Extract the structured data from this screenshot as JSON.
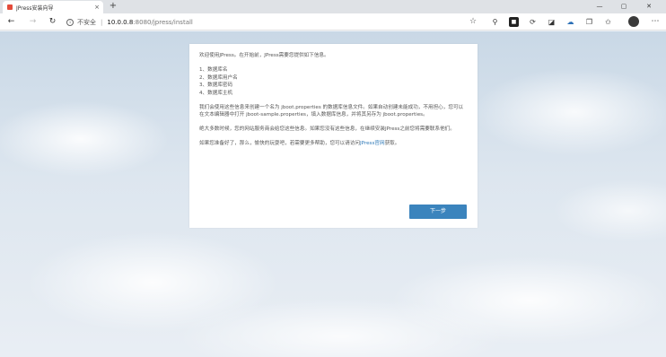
{
  "browser": {
    "tab_title": "JPress安装向导",
    "tab_close": "×",
    "new_tab": "+",
    "win_min": "—",
    "win_max": "▢",
    "win_close": "✕",
    "back": "←",
    "forward": "→",
    "reload": "↻",
    "security_label": "不安全",
    "separator": "|",
    "url_host": "10.0.0.8",
    "url_rest": ":8080/jpress/install",
    "star": "☆",
    "menu": "⋯"
  },
  "install": {
    "intro": "欢迎使用JPress。在开始前，JPress需要您提供如下信息。",
    "items": [
      "1、数据库名",
      "2、数据库用户名",
      "3、数据库密码",
      "4、数据库主机"
    ],
    "para1": "我们会使用这些信息来创建一个名为 jboot.properties 的数据库信息文件。如果自动创建未能成功，不用担心，您可以在文本编辑器中打开 jboot-sample.properties，填入数据库信息，并将其另存为 jboot.properties。",
    "para2": "绝大多数时候，您的网站服务商会给您这些信息。如果您没有这些信息，在继续安装JPress之前您将需要联系他们。",
    "para3_before": "如果您准备好了，那么，愉快的玩耍吧，若需要更多帮助，您可以请访问",
    "para3_link": "JPress官网",
    "para3_after": "获取。",
    "next_button": "下一步"
  },
  "colors": {
    "accent": "#3b84bd",
    "link": "#2f7ab8"
  }
}
